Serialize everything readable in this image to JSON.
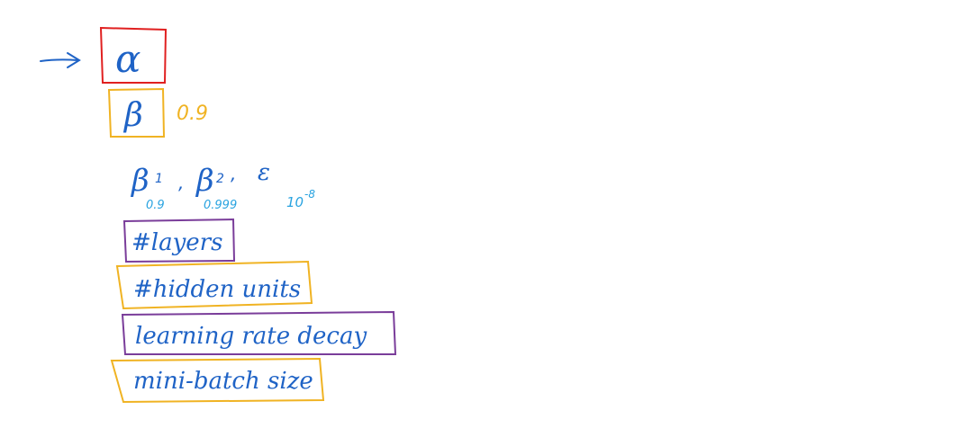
{
  "notes": {
    "alpha": {
      "symbol": "α"
    },
    "beta": {
      "symbol": "β",
      "value": "0.9"
    },
    "adam_params": {
      "beta1": {
        "symbol": "β",
        "subscript": "1",
        "value": "0.9"
      },
      "beta2": {
        "symbol": "β",
        "subscript": "2",
        "value": "0.999"
      },
      "epsilon": {
        "symbol": "ε",
        "value": "10",
        "exponent": "-8"
      }
    },
    "items": [
      {
        "label": "#layers"
      },
      {
        "label": "#hidden units"
      },
      {
        "label": "learning rate decay"
      },
      {
        "label": "mini-batch size"
      }
    ]
  },
  "colors": {
    "ink_blue": "#1f63c6",
    "ink_lightblue": "#29a3e0",
    "red": "#e02020",
    "orange": "#f0b323",
    "purple": "#7a3d9a"
  }
}
